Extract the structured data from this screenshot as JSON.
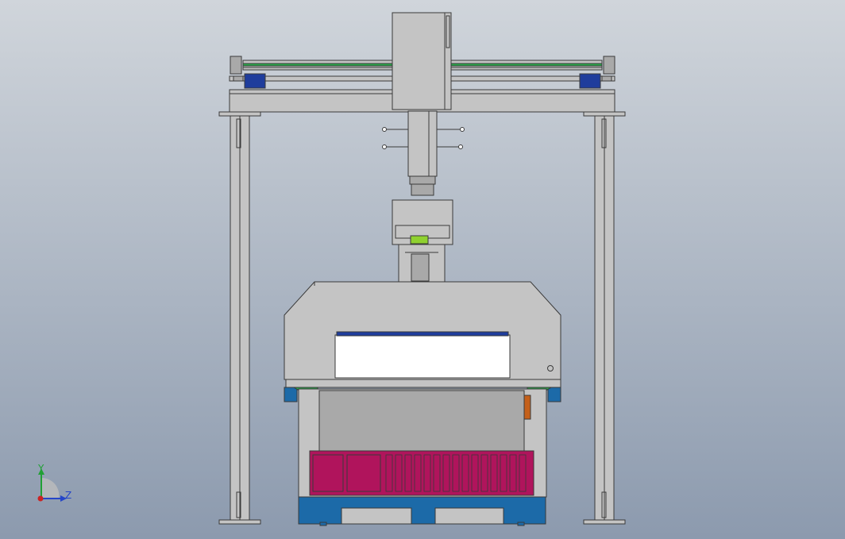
{
  "viewport": {
    "background_top": "#d0d5db",
    "background_bottom": "#8c9aae"
  },
  "colors": {
    "steel": "#c4c4c4",
    "steel_dark": "#a9a9a9",
    "outline": "#3a3a3a",
    "mount_blue": "#1f3d9c",
    "platform_blue": "#1c6aa8",
    "rail_green": "#2aa84a",
    "chuck_green": "#8fd12f",
    "purple": "#6a1fa0",
    "magenta": "#b0145c",
    "orange": "#c4601a",
    "axis_x": "#cc2222",
    "axis_y": "#21a035",
    "axis_z": "#2646c8"
  },
  "triad": {
    "y_label": "Y",
    "z_label": "Z"
  }
}
